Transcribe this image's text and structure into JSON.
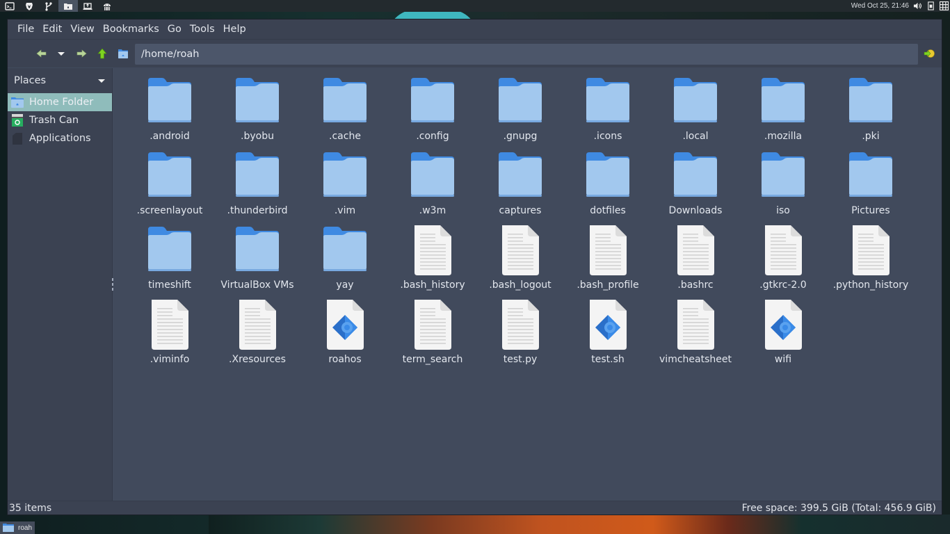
{
  "top_panel": {
    "apps": [
      {
        "name": "terminal-icon",
        "active": false
      },
      {
        "name": "brave-browser-icon",
        "active": false
      },
      {
        "name": "git-branch-icon",
        "active": false
      },
      {
        "name": "file-manager-icon",
        "active": true
      },
      {
        "name": "laptop-upload-icon",
        "active": false
      },
      {
        "name": "cupcake-icon",
        "active": false
      }
    ],
    "clock": "Wed Oct 25, 21:46",
    "tray": [
      "volume-icon",
      "battery-icon",
      "workspace-grid-icon"
    ]
  },
  "window": {
    "menu": [
      "File",
      "Edit",
      "View",
      "Bookmarks",
      "Go",
      "Tools",
      "Help"
    ],
    "toolbar": {
      "back_label": "Back",
      "history_label": "History",
      "forward_label": "Forward",
      "up_label": "Up",
      "home_label": "Home",
      "location": "/home/roah",
      "go_label": "Go"
    },
    "sidebar": {
      "header": "Places",
      "items": [
        {
          "label": "Home Folder",
          "icon": "home-folder-icon",
          "selected": true
        },
        {
          "label": "Trash Can",
          "icon": "trash-icon",
          "selected": false
        },
        {
          "label": "Applications",
          "icon": "applications-icon",
          "selected": false
        }
      ]
    },
    "files": [
      {
        "name": ".android",
        "type": "folder"
      },
      {
        "name": ".byobu",
        "type": "folder"
      },
      {
        "name": ".cache",
        "type": "folder"
      },
      {
        "name": ".config",
        "type": "folder"
      },
      {
        "name": ".gnupg",
        "type": "folder"
      },
      {
        "name": ".icons",
        "type": "folder"
      },
      {
        "name": ".local",
        "type": "folder"
      },
      {
        "name": ".mozilla",
        "type": "folder"
      },
      {
        "name": ".pki",
        "type": "folder"
      },
      {
        "name": ".screenlayout",
        "type": "folder"
      },
      {
        "name": ".thunderbird",
        "type": "folder"
      },
      {
        "name": ".vim",
        "type": "folder"
      },
      {
        "name": ".w3m",
        "type": "folder"
      },
      {
        "name": "captures",
        "type": "folder"
      },
      {
        "name": "dotfiles",
        "type": "folder"
      },
      {
        "name": "Downloads",
        "type": "folder"
      },
      {
        "name": "iso",
        "type": "folder"
      },
      {
        "name": "Pictures",
        "type": "folder"
      },
      {
        "name": "timeshift",
        "type": "folder"
      },
      {
        "name": "VirtualBox VMs",
        "type": "folder"
      },
      {
        "name": "yay",
        "type": "folder"
      },
      {
        "name": ".bash_history",
        "type": "text"
      },
      {
        "name": ".bash_logout",
        "type": "text"
      },
      {
        "name": ".bash_profile",
        "type": "text"
      },
      {
        "name": ".bashrc",
        "type": "text"
      },
      {
        "name": ".gtkrc-2.0",
        "type": "text"
      },
      {
        "name": ".python_history",
        "type": "text"
      },
      {
        "name": ".viminfo",
        "type": "text"
      },
      {
        "name": ".Xresources",
        "type": "text"
      },
      {
        "name": "roahos",
        "type": "script"
      },
      {
        "name": "term_search",
        "type": "text"
      },
      {
        "name": "test.py",
        "type": "text"
      },
      {
        "name": "test.sh",
        "type": "script"
      },
      {
        "name": "vimcheatsheet",
        "type": "text"
      },
      {
        "name": "wifi",
        "type": "script"
      }
    ],
    "status": {
      "item_count": "35 items",
      "free_space": "Free space: 399.5 GiB (Total: 456.9 GiB)"
    }
  },
  "taskbar": {
    "items": [
      {
        "label": "roah",
        "icon": "folder-icon"
      }
    ]
  },
  "colors": {
    "selection": "#8fbcbb",
    "folder_back": "#3f8ae2",
    "folder_front": "#a2c8ee"
  }
}
